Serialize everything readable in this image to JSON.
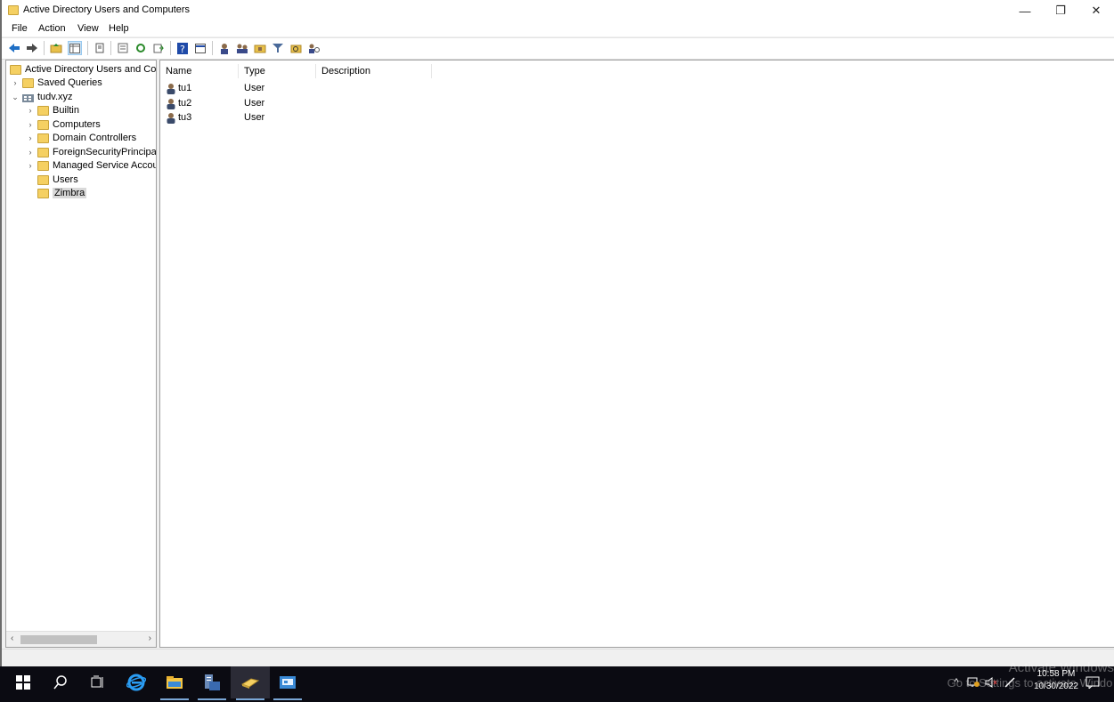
{
  "window": {
    "title": "Active Directory Users and Computers",
    "controls": {
      "minimize": "—",
      "restore": "❐",
      "close": "✕"
    }
  },
  "menu": [
    "File",
    "Action",
    "View",
    "Help"
  ],
  "toolbar_icons": [
    "back-arrow-icon",
    "forward-arrow-icon",
    "up-folder-icon",
    "show-console-tree-icon",
    "properties-icon",
    "export-list-icon",
    "refresh-icon",
    "export-icon",
    "help-icon",
    "console-view-icon",
    "new-user-icon",
    "new-group-icon",
    "new-ou-icon",
    "filter-icon",
    "find-icon",
    "delegate-control-icon"
  ],
  "tree": {
    "root": "Active Directory Users and Com",
    "saved_queries": "Saved Queries",
    "domain": "tudv.xyz",
    "children": [
      "Builtin",
      "Computers",
      "Domain Controllers",
      "ForeignSecurityPrincipals",
      "Managed Service Accour",
      "Users",
      "Zimbra"
    ]
  },
  "list": {
    "columns": [
      "Name",
      "Type",
      "Description"
    ],
    "rows": [
      {
        "name": "tu1",
        "type": "User"
      },
      {
        "name": "tu2",
        "type": "User"
      },
      {
        "name": "tu3",
        "type": "User"
      }
    ]
  },
  "taskbar": {
    "time": "10:58 PM",
    "date": "10/30/2022",
    "watermark_line1": "Activate Windows",
    "watermark_line2": "Go to Settings to activate Windo"
  },
  "colors": {
    "accent": "#0078d7",
    "folder": "#f5d062",
    "taskbar": "#0b0b12"
  }
}
